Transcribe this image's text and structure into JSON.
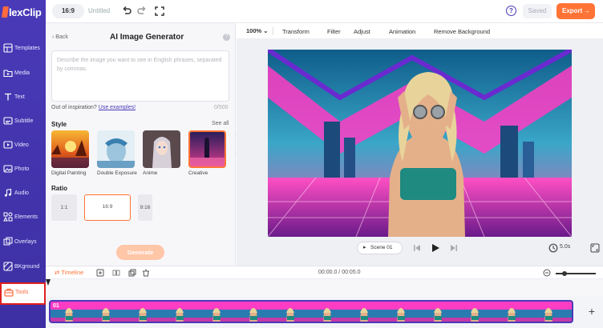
{
  "app": {
    "logo_text": "lexClip",
    "project_title": "Untitled",
    "aspect": "16:9",
    "saved_label": "Saved",
    "export_label": "Export",
    "help": "?"
  },
  "sidebar": {
    "items": [
      {
        "label": "Templates",
        "icon": "templates-icon"
      },
      {
        "label": "Media",
        "icon": "media-icon"
      },
      {
        "label": "Text",
        "icon": "text-icon"
      },
      {
        "label": "Subtitle",
        "icon": "subtitle-icon"
      },
      {
        "label": "Video",
        "icon": "video-icon"
      },
      {
        "label": "Photo",
        "icon": "photo-icon"
      },
      {
        "label": "Audio",
        "icon": "audio-icon"
      },
      {
        "label": "Elements",
        "icon": "elements-icon"
      },
      {
        "label": "Overlays",
        "icon": "overlays-icon"
      },
      {
        "label": "BKground",
        "icon": "background-icon"
      },
      {
        "label": "Tools",
        "icon": "tools-icon"
      }
    ],
    "active": "Tools"
  },
  "panel": {
    "back_label": "Back",
    "title": "AI Image Generator",
    "prompt_placeholder": "Describe the image you want to see in English phrases, separated by commas.",
    "inspiration_text": "Out of inspiration?",
    "inspiration_link": "Use examples!",
    "char_count": "0/500",
    "style_heading": "Style",
    "see_all": "See all",
    "styles": [
      {
        "label": "Digital Painting"
      },
      {
        "label": "Double Exposure"
      },
      {
        "label": "Anime"
      },
      {
        "label": "Creative"
      }
    ],
    "selected_style": "Creative",
    "ratio_heading": "Ratio",
    "ratios": [
      {
        "label": "1:1"
      },
      {
        "label": "16:9"
      },
      {
        "label": "9:16"
      }
    ],
    "selected_ratio": "16:9",
    "generate_label": "Generate"
  },
  "edit_toolbar": {
    "zoom": "100%",
    "items": [
      "Transform",
      "Filter",
      "Adjust",
      "Animation",
      "Remove Background"
    ]
  },
  "player": {
    "scene_label": "Scene",
    "scene_number": "01",
    "duration": "5.0s"
  },
  "timeline": {
    "label": "Timeline",
    "time": "00:00.0 / 00:05.0",
    "clip_label": "01",
    "add": "+"
  },
  "colors": {
    "sidebar": "#4a3ab8",
    "accent": "#ff7436",
    "active_border": "#e02020"
  }
}
